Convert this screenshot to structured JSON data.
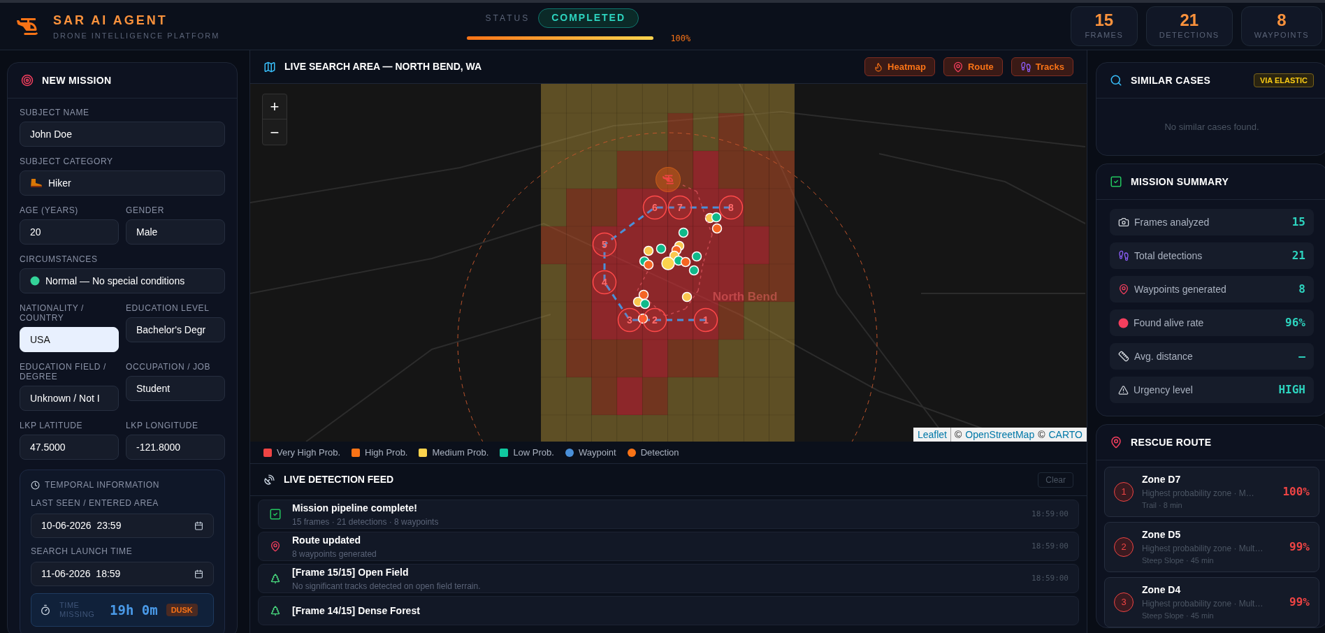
{
  "header": {
    "title": "SAR AI AGENT",
    "subtitle": "DRONE INTELLIGENCE PLATFORM",
    "status_label": "STATUS",
    "status": "COMPLETED",
    "progress": {
      "level": 1,
      "text": "100%"
    },
    "stats": [
      {
        "value": "15",
        "label": "FRAMES"
      },
      {
        "value": "21",
        "label": "DETECTIONS"
      },
      {
        "value": "8",
        "label": "WAYPOINTS"
      }
    ]
  },
  "mission": {
    "title": "NEW MISSION",
    "rows": [
      [
        {
          "label": "SUBJECT NAME",
          "value": "John Doe",
          "kind": "text",
          "focused": false
        }
      ],
      [
        {
          "label": "SUBJECT CATEGORY",
          "value": "Hiker",
          "kind": "category",
          "focused": false
        }
      ],
      [
        {
          "label": "AGE (YEARS)",
          "value": "20",
          "kind": "text",
          "focused": false
        },
        {
          "label": "GENDER",
          "value": "Male",
          "kind": "text",
          "focused": false
        }
      ],
      [
        {
          "label": "CIRCUMSTANCES",
          "value": "Normal — No special conditions",
          "kind": "condition",
          "focused": false
        }
      ],
      [
        {
          "label": "NATIONALITY / COUNTRY",
          "value": "USA",
          "kind": "text",
          "focused": true
        },
        {
          "label": "EDUCATION LEVEL",
          "value": "Bachelor's Degr",
          "kind": "text",
          "focused": false
        }
      ],
      [
        {
          "label": "EDUCATION FIELD / DEGREE",
          "value": "Unknown / Not I",
          "kind": "text",
          "focused": false
        },
        {
          "label": "OCCUPATION / JOB",
          "value": "Student",
          "kind": "text",
          "focused": false
        }
      ],
      [
        {
          "label": "LKP LATITUDE",
          "value": "47.5000",
          "kind": "text",
          "focused": false
        },
        {
          "label": "LKP LONGITUDE",
          "value": "-121.8000",
          "kind": "text",
          "focused": false
        }
      ]
    ],
    "temporal": {
      "title": "TEMPORAL INFORMATION",
      "fields": [
        {
          "label": "LAST SEEN / ENTERED AREA",
          "value": "10-06-2026  23:59"
        },
        {
          "label": "SEARCH LAUNCH TIME",
          "value": "11-06-2026  18:59"
        }
      ],
      "time_missing": {
        "label": "TIME MISSING",
        "value": "19h 0m",
        "badge": "DUSK"
      }
    }
  },
  "map": {
    "title": "LIVE SEARCH AREA — NORTH BEND, WA",
    "layers": [
      {
        "label": "Heatmap",
        "selected": true
      },
      {
        "label": "Route",
        "selected": true
      },
      {
        "label": "Tracks",
        "selected": true
      }
    ],
    "zoom_in": "+",
    "zoom_out": "−",
    "place_label": "North Bend",
    "waypoints": [
      "6",
      "7",
      "8",
      "5",
      "4",
      "3",
      "2",
      "1"
    ],
    "attribution": [
      {
        "text": "Leaflet",
        "kind": "link"
      },
      {
        "text": "©",
        "kind": "plain"
      },
      {
        "text": "OpenStreetMap",
        "kind": "link"
      },
      {
        "text": "©",
        "kind": "plain"
      },
      {
        "text": "CARTO",
        "kind": "link"
      }
    ],
    "legend": [
      {
        "label": "Very High Prob.",
        "color": "#ef4444",
        "kind": "square"
      },
      {
        "label": "High Prob.",
        "color": "#f97316",
        "kind": "square"
      },
      {
        "label": "Medium Prob.",
        "color": "#fcd34d",
        "kind": "square"
      },
      {
        "label": "Low Prob.",
        "color": "#10c9a0",
        "kind": "square"
      },
      {
        "label": "Waypoint",
        "color": "#4a90d9",
        "kind": "circle"
      },
      {
        "label": "Detection",
        "color": "#f97316",
        "kind": "circle"
      }
    ]
  },
  "feed": {
    "title": "LIVE DETECTION FEED",
    "clear": "Clear",
    "items": [
      {
        "kind": "complete",
        "title": "Mission pipeline complete!",
        "detail": "15 frames · 21 detections · 8 waypoints",
        "time": "18:59:00"
      },
      {
        "kind": "route",
        "title": "Route updated",
        "detail": "8 waypoints generated",
        "time": "18:59:00"
      },
      {
        "kind": "frame",
        "title": "[Frame 15/15] Open Field",
        "detail": "No significant tracks detected on open field terrain.",
        "time": "18:59:00"
      },
      {
        "kind": "frame",
        "title": "[Frame 14/15] Dense Forest"
      }
    ]
  },
  "similar": {
    "title": "SIMILAR CASES",
    "badge": "VIA ELASTIC",
    "empty": "No similar cases found."
  },
  "summary": {
    "title": "MISSION SUMMARY",
    "rows": [
      {
        "label": "Frames analyzed",
        "value": "15"
      },
      {
        "label": "Total detections",
        "value": "21"
      },
      {
        "label": "Waypoints generated",
        "value": "8"
      },
      {
        "label": "Found alive rate",
        "value": "96%"
      },
      {
        "label": "Avg. distance",
        "value": "—"
      },
      {
        "label": "Urgency level",
        "value": "HIGH"
      }
    ]
  },
  "route": {
    "title": "RESCUE ROUTE",
    "items": [
      {
        "number": "1",
        "name": "Zone D7",
        "description": "Highest probability zone · M…",
        "meta": "Trail · 8 min",
        "probability": "100%"
      },
      {
        "number": "2",
        "name": "Zone D5",
        "description": "Highest probability zone · Mult…",
        "meta": "Steep Slope · 45 min",
        "probability": "99%"
      },
      {
        "number": "3",
        "name": "Zone D4",
        "description": "Highest probability zone · Mult…",
        "meta": "Steep Slope · 45 min",
        "probability": "99%"
      }
    ]
  }
}
